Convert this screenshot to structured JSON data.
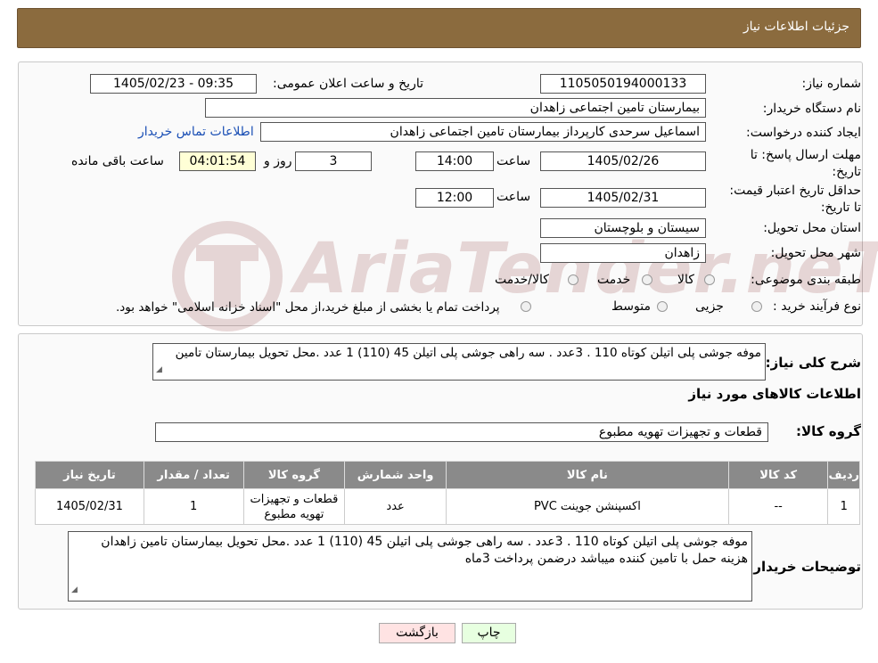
{
  "header": {
    "title": "جزئیات اطلاعات نیاز"
  },
  "fields": {
    "need_number_label": "شماره نیاز:",
    "need_number": "1105050194000133",
    "announce_label": "تاریخ و ساعت اعلان عمومی:",
    "announce_value": "1405/02/23 - 09:35",
    "buyer_org_label": "نام دستگاه خریدار:",
    "buyer_org": "بیمارستان تامین اجتماعی زاهدان",
    "requester_label": "ایجاد کننده درخواست:",
    "requester": "اسماعیل سرحدی کارپرداز بیمارستان تامین اجتماعی زاهدان",
    "contact_link": "اطلاعات تماس خریدار",
    "deadline_label": "مهلت ارسال پاسخ: تا تاریخ:",
    "deadline_date": "1405/02/26",
    "time_label": "ساعت",
    "deadline_time": "14:00",
    "days_value": "3",
    "days_label": "روز و",
    "remaining_time": "04:01:54",
    "remaining_label": "ساعت باقی مانده",
    "min_valid_label": "حداقل تاریخ اعتبار قیمت: تا تاریخ:",
    "min_valid_date": "1405/02/31",
    "min_valid_time": "12:00",
    "province_label": "استان محل تحویل:",
    "province": "سیستان و بلوچستان",
    "city_label": "شهر محل تحویل:",
    "city": "زاهدان",
    "category_label": "طبقه بندی موضوعی:",
    "category_options": [
      "کالا",
      "خدمت",
      "کالا/خدمت"
    ],
    "process_label": "نوع فرآیند خرید :",
    "process_options": [
      "جزیی",
      "متوسط"
    ],
    "process_note": "پرداخت تمام یا بخشی از مبلغ خرید،از محل \"اسناد خزانه اسلامی\" خواهد بود."
  },
  "description": {
    "label": "شرح کلی نیاز:",
    "text": "موفه جوشی پلی اتیلن کوتاه 110 . 3عدد . سه راهی جوشی پلی اتیلن 45 (110) 1 عدد .محل تحویل بیمارستان تامین"
  },
  "goods_info_title": "اطلاعات کالاهای مورد نیاز",
  "goods_group": {
    "label": "گروه کالا:",
    "value": "قطعات و تجهیزات تهویه مطبوع"
  },
  "table": {
    "headers": [
      "ردیف",
      "کد کالا",
      "نام کالا",
      "واحد شمارش",
      "گروه کالا",
      "تعداد / مقدار",
      "تاریخ نیاز"
    ],
    "rows": [
      [
        "1",
        "--",
        "اکسپنشن جوینت PVC",
        "عدد",
        "قطعات و تجهیزات تهویه مطبوع",
        "1",
        "1405/02/31"
      ]
    ]
  },
  "buyer_notes": {
    "label": "توضیحات خریدار:",
    "text": "موفه جوشی پلی اتیلن کوتاه 110 . 3عدد . سه راهی جوشی پلی اتیلن 45 (110) 1 عدد .محل تحویل بیمارستان تامین زاهدان هزینه حمل با تامین کننده میباشد درضمن پرداخت 3ماه"
  },
  "buttons": {
    "print": "چاپ",
    "back": "بازگشت"
  },
  "watermark": {
    "text": "AriaTender.neT"
  },
  "colors": {
    "header_bg": "#8b6b3e",
    "table_header_bg": "#8a8a8a",
    "link": "#1a4fb5"
  }
}
